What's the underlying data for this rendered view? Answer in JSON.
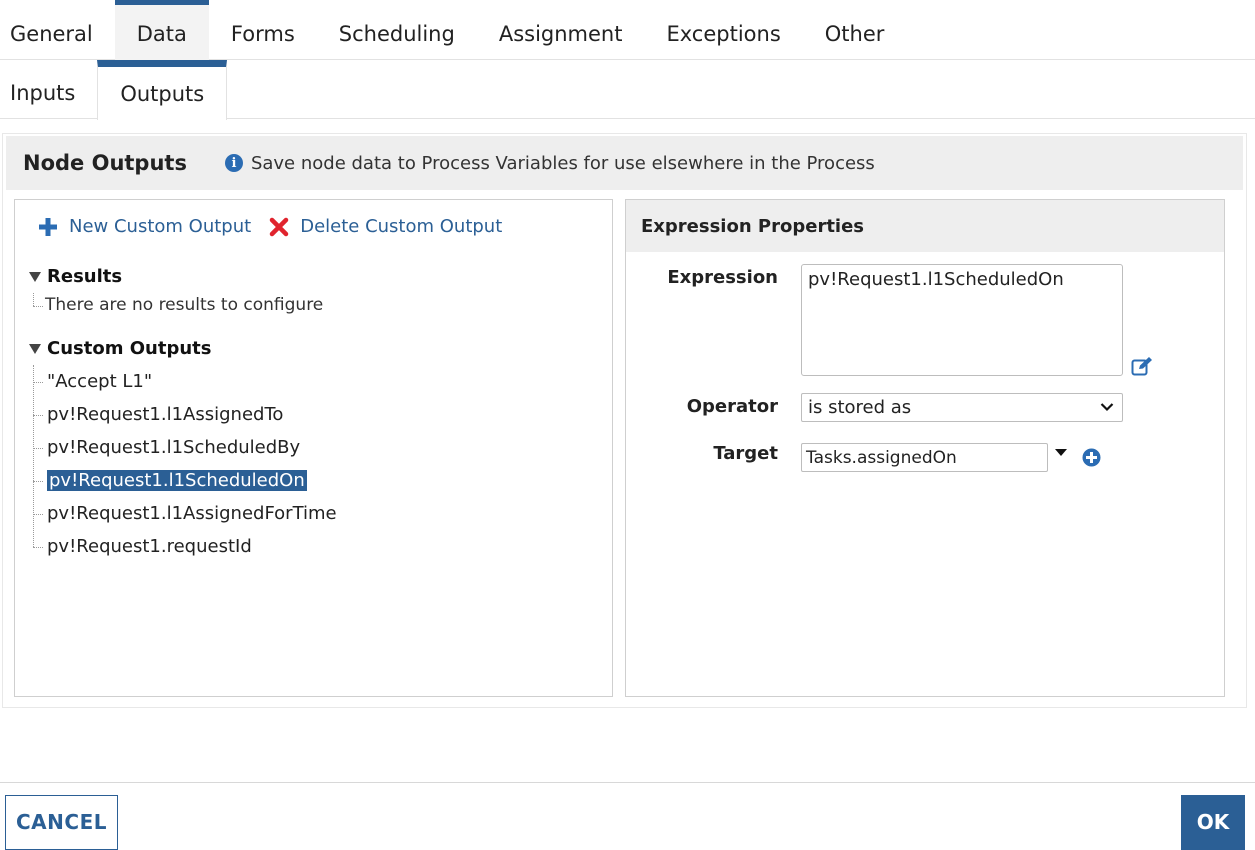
{
  "tabs_top": [
    {
      "label": "General",
      "active": false
    },
    {
      "label": "Data",
      "active": true
    },
    {
      "label": "Forms",
      "active": false
    },
    {
      "label": "Scheduling",
      "active": false
    },
    {
      "label": "Assignment",
      "active": false
    },
    {
      "label": "Exceptions",
      "active": false
    },
    {
      "label": "Other",
      "active": false
    }
  ],
  "tabs_sub": [
    {
      "label": "Inputs",
      "active": false
    },
    {
      "label": "Outputs",
      "active": true
    }
  ],
  "node_outputs": {
    "title": "Node Outputs",
    "info_text": "Save node data to Process Variables for use elsewhere in the Process",
    "icon": "info-icon"
  },
  "toolbar": {
    "new_label": "New Custom Output",
    "new_icon": "plus-icon",
    "delete_label": "Delete Custom Output",
    "delete_icon": "x-icon"
  },
  "tree": {
    "results_label": "Results",
    "results_empty": "There are no results to configure",
    "custom_label": "Custom Outputs",
    "custom_items": [
      "\"Accept L1\"",
      "pv!Request1.l1AssignedTo",
      "pv!Request1.l1ScheduledBy",
      "pv!Request1.l1ScheduledOn",
      "pv!Request1.l1AssignedForTime",
      "pv!Request1.requestId"
    ],
    "selected_index": 3
  },
  "expression_properties": {
    "title": "Expression Properties",
    "expression_label": "Expression",
    "expression_value": "pv!Request1.l1ScheduledOn",
    "operator_label": "Operator",
    "operator_value": "is stored as",
    "target_label": "Target",
    "target_value": "Tasks.assignedOn"
  },
  "footer": {
    "cancel_label": "CANCEL",
    "ok_label": "OK"
  },
  "colors": {
    "accent": "#2b5f95",
    "delete_red": "#e0242e",
    "header_gray": "#eeeeee"
  }
}
